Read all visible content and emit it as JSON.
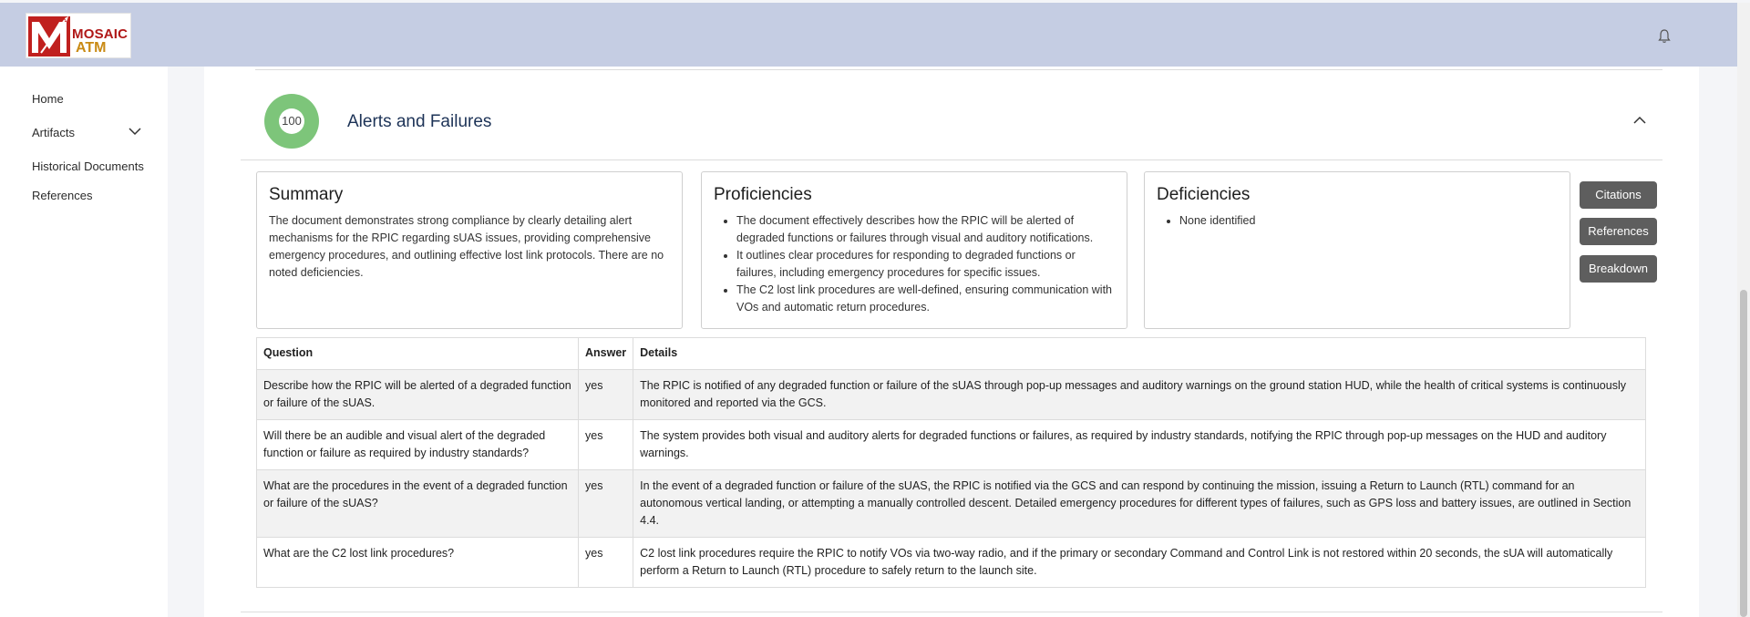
{
  "header": {
    "logo_line1": "MOSAIC",
    "logo_line2": "ATM",
    "bell_icon": "bell-icon"
  },
  "sidebar": {
    "items": [
      {
        "label": "Home"
      },
      {
        "label": "Artifacts",
        "icon": "chevron-down-icon"
      },
      {
        "label": "Historical Documents"
      },
      {
        "label": "References"
      }
    ]
  },
  "section": {
    "score": "100",
    "score_color": "#7dc57a",
    "title": "Alerts and Failures",
    "collapse_icon": "chevron-up-icon"
  },
  "summary": {
    "title": "Summary",
    "text": "The document demonstrates strong compliance by clearly detailing alert mechanisms for the RPIC regarding sUAS issues, providing comprehensive emergency procedures, and outlining effective lost link protocols. There are no noted deficiencies."
  },
  "proficiencies": {
    "title": "Proficiencies",
    "items": [
      "The document effectively describes how the RPIC will be alerted of degraded functions or failures through visual and auditory notifications.",
      "It outlines clear procedures for responding to degraded functions or failures, including emergency procedures for specific issues.",
      "The C2 lost link procedures are well-defined, ensuring communication with VOs and automatic return procedures."
    ]
  },
  "deficiencies": {
    "title": "Deficiencies",
    "items": [
      "None identified"
    ]
  },
  "buttons": {
    "citations": "Citations",
    "references": "References",
    "breakdown": "Breakdown"
  },
  "table": {
    "headers": [
      "Question",
      "Answer",
      "Details"
    ],
    "rows": [
      {
        "question": "Describe how the RPIC will be alerted of a degraded function or failure of the sUAS.",
        "answer": "yes",
        "details": "The RPIC is notified of any degraded function or failure of the sUAS through pop-up messages and auditory warnings on the ground station HUD, while the health of critical systems is continuously monitored and reported via the GCS."
      },
      {
        "question": "Will there be an audible and visual alert of the degraded function or failure as required by industry standards?",
        "answer": "yes",
        "details": "The system provides both visual and auditory alerts for degraded functions or failures, as required by industry standards, notifying the RPIC through pop-up messages on the HUD and auditory warnings."
      },
      {
        "question": "What are the procedures in the event of a degraded function or failure of the sUAS?",
        "answer": "yes",
        "details": "In the event of a degraded function or failure of the sUAS, the RPIC is notified via the GCS and can respond by continuing the mission, issuing a Return to Launch (RTL) command for an autonomous vertical landing, or attempting a manually controlled descent. Detailed emergency procedures for different types of failures, such as GPS loss and battery issues, are outlined in Section 4.4."
      },
      {
        "question": "What are the C2 lost link procedures?",
        "answer": "yes",
        "details": "C2 lost link procedures require the RPIC to notify VOs via two-way radio, and if the primary or secondary Command and Control Link is not restored within 20 seconds, the sUA will automatically perform a Return to Launch (RTL) procedure to safely return to the launch site."
      }
    ]
  }
}
